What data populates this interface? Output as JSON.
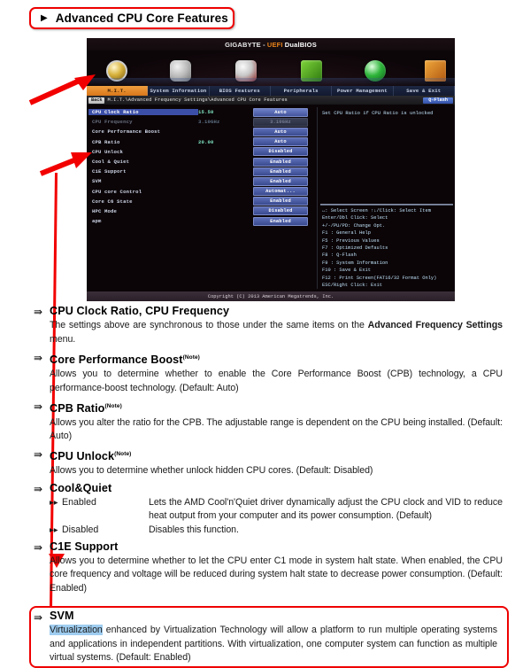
{
  "header": {
    "title": "Advanced CPU Core Features",
    "arrow_icon": "triangle-right-icon"
  },
  "bios": {
    "brand_gigabyte": "GIGABYTE -",
    "brand_uefi": "UEFI",
    "brand_dualbios": "DualBIOS",
    "menu": [
      "M.I.T.",
      "System Information",
      "BIOS Features",
      "Peripherals",
      "Power Management",
      "Save & Exit"
    ],
    "active_menu_index": 0,
    "back_label": "Back",
    "breadcrumb": "M.I.T.\\Advanced Frequency Settings\\Advanced CPU Core Features",
    "qflash_label": "Q-Flash",
    "settings": [
      {
        "name": "CPU Clock Ratio",
        "value": "15.50",
        "option": "Auto",
        "selected": true,
        "dim": false
      },
      {
        "name": "CPU Frequency",
        "value": "3.10GHz",
        "option": "3.10GHz",
        "selected": false,
        "dim": true
      },
      {
        "name": "Core Performance Boost",
        "value": "",
        "option": "Auto",
        "selected": false,
        "dim": false
      },
      {
        "name": "CPB Ratio",
        "value": "20.00",
        "option": "Auto",
        "selected": false,
        "dim": false
      },
      {
        "name": "CPU Unlock",
        "value": "",
        "option": "Disabled",
        "selected": false,
        "dim": false
      },
      {
        "name": "Cool & Quiet",
        "value": "",
        "option": "Enabled",
        "selected": false,
        "dim": false
      },
      {
        "name": "C1E Support",
        "value": "",
        "option": "Enabled",
        "selected": false,
        "dim": false
      },
      {
        "name": "SVM",
        "value": "",
        "option": "Enabled",
        "selected": false,
        "dim": false
      },
      {
        "name": "CPU core Control",
        "value": "",
        "option": "Automat...",
        "selected": false,
        "dim": false
      },
      {
        "name": "Core C6 State",
        "value": "",
        "option": "Enabled",
        "selected": false,
        "dim": false
      },
      {
        "name": "HPC Mode",
        "value": "",
        "option": "Disabled",
        "selected": false,
        "dim": false
      },
      {
        "name": "apm",
        "value": "",
        "option": "Enabled",
        "selected": false,
        "dim": false
      }
    ],
    "help_text": "Set CPU Ratio if CPU Ratio is unlocked",
    "help_keys": [
      "↔: Select Screen   ↑↓/Click: Select Item",
      "Enter/Dbl Click: Select",
      "+/-/PU/PD: Change Opt.",
      "F1  : General Help",
      "F5  : Previous Values",
      "F7  : Optimized Defaults",
      "F8  : Q-Flash",
      "F9  : System Information",
      "F10 : Save & Exit",
      "F12 : Print Screen(FAT16/32 Format Only)",
      "ESC/Right Click: Exit"
    ],
    "copyright": "Copyright (C) 2013 American Megatrends, Inc."
  },
  "doc": {
    "note_marker": "(Note)",
    "sections": [
      {
        "id": "cpu-clock-ratio",
        "heading": "CPU Clock Ratio, CPU Frequency",
        "note": false,
        "body_pre": "The settings above are synchronous to those under the same items on the ",
        "body_bold": "Advanced Frequency Settings",
        "body_post": " menu."
      },
      {
        "id": "core-performance-boost",
        "heading": "Core Performance Boost",
        "note": true,
        "body": "Allows you to determine whether to enable the Core Performance Boost (CPB) technology, a CPU performance-boost technology. (Default: Auto)"
      },
      {
        "id": "cpb-ratio",
        "heading": "CPB Ratio",
        "note": true,
        "body": "Allows you alter the ratio for the CPB. The adjustable range is dependent on the CPU being installed. (Default: Auto)"
      },
      {
        "id": "cpu-unlock",
        "heading": "CPU Unlock",
        "note": true,
        "body": "Allows you to determine whether unlock hidden CPU cores.  (Default: Disabled)"
      }
    ],
    "cool_quiet": {
      "heading": "Cool&Quiet",
      "options": [
        {
          "label": "Enabled",
          "desc": "Lets the AMD Cool'n'Quiet driver dynamically adjust the CPU clock and VID to reduce heat output from your computer and its power consumption. (Default)"
        },
        {
          "label": "Disabled",
          "desc": "Disables this function."
        }
      ],
      "option_arrow": "double-chevron-right-icon"
    },
    "c1e": {
      "heading": "C1E Support",
      "body": "Allows you to determine whether to let the CPU enter C1 mode in system halt state. When enabled, the CPU core frequency and voltage will be reduced during system halt state to decrease power consumption. (Default: Enabled)"
    },
    "svm": {
      "heading": "SVM",
      "highlight": "Virtualization",
      "body_rest": " enhanced by Virtualization Technology will allow a platform to run multiple operating systems and applications in independent partitions. With virtualization, one computer system can function as multiple virtual systems.  (Default: Enabled)"
    }
  },
  "colors": {
    "annotation_red": "#ee0000",
    "highlight_blue": "#9fcdf0",
    "bios_accent_orange": "#e8821a",
    "bios_option_blue": "#4a5aa0"
  }
}
